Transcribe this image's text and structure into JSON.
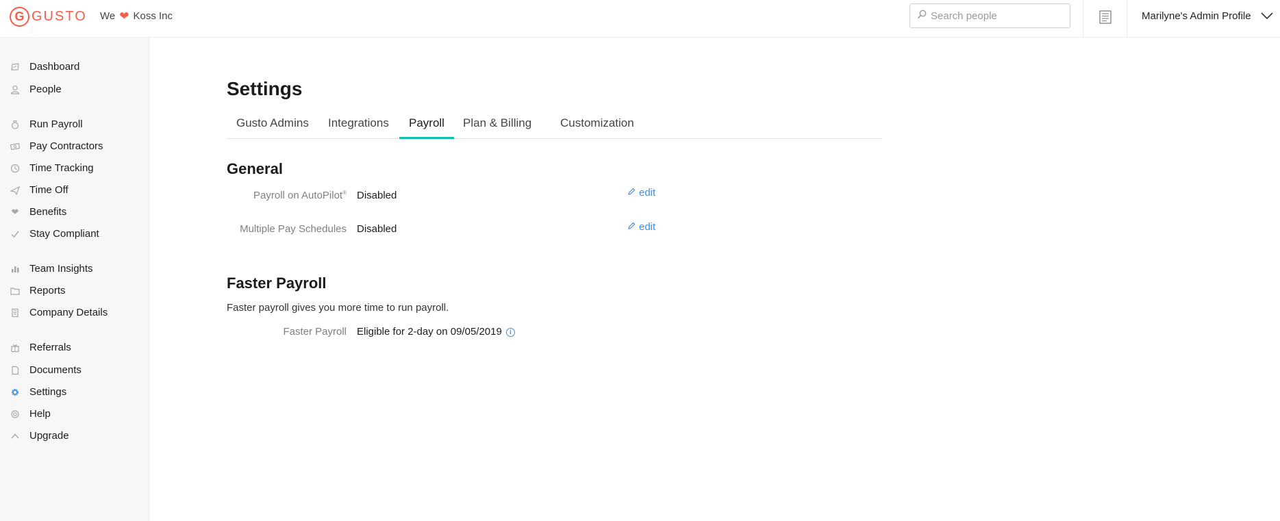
{
  "brand": {
    "logo_letter": "G",
    "logo_word": "GUSTO",
    "tagline_prefix": "We",
    "company": "Koss Inc"
  },
  "header": {
    "search_placeholder": "Search people",
    "profile_label": "Marilyne's Admin Profile"
  },
  "sidebar": {
    "items": [
      {
        "label": "Dashboard",
        "icon": "dashboard-icon"
      },
      {
        "label": "People",
        "icon": "person-icon"
      },
      {
        "label": "Run Payroll",
        "icon": "money-bag-icon"
      },
      {
        "label": "Pay Contractors",
        "icon": "cash-icon"
      },
      {
        "label": "Time Tracking",
        "icon": "clock-icon"
      },
      {
        "label": "Time Off",
        "icon": "airplane-icon"
      },
      {
        "label": "Benefits",
        "icon": "heart-icon"
      },
      {
        "label": "Stay Compliant",
        "icon": "check-icon"
      },
      {
        "label": "Team Insights",
        "icon": "bar-chart-icon"
      },
      {
        "label": "Reports",
        "icon": "folder-icon"
      },
      {
        "label": "Company Details",
        "icon": "building-icon"
      },
      {
        "label": "Referrals",
        "icon": "gift-icon"
      },
      {
        "label": "Documents",
        "icon": "document-icon"
      },
      {
        "label": "Settings",
        "icon": "gear-icon",
        "active": true
      },
      {
        "label": "Help",
        "icon": "lifebuoy-icon"
      },
      {
        "label": "Upgrade",
        "icon": "chevron-up-icon"
      }
    ]
  },
  "page": {
    "title": "Settings",
    "tabs": [
      {
        "label": "Gusto Admins"
      },
      {
        "label": "Integrations"
      },
      {
        "label": "Payroll",
        "active": true
      },
      {
        "label": "Plan & Billing"
      },
      {
        "label": "Customization"
      }
    ],
    "general": {
      "title": "General",
      "rows": [
        {
          "label": "Payroll on AutoPilot",
          "label_sup": "®",
          "value": "Disabled",
          "action": "edit"
        },
        {
          "label": "Multiple Pay Schedules",
          "value": "Disabled",
          "action": "edit"
        }
      ]
    },
    "faster_payroll": {
      "title": "Faster Payroll",
      "description": "Faster payroll gives you more time to run payroll.",
      "label": "Faster Payroll",
      "value": "Eligible for 2-day on 09/05/2019"
    }
  },
  "colors": {
    "brand": "#f45d48",
    "accent_tab": "#0fbfa8",
    "link": "#3f8edc"
  }
}
